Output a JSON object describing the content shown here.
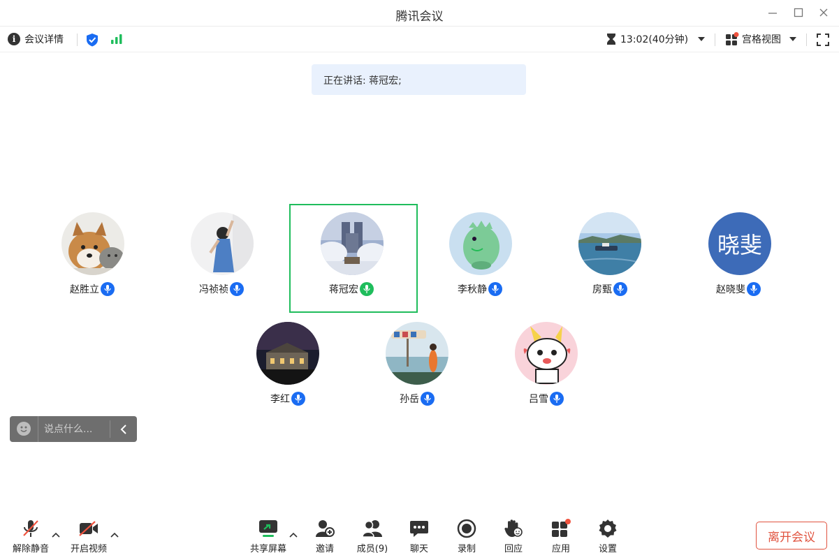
{
  "app": {
    "title": "腾讯会议"
  },
  "infobar": {
    "details_label": "会议详情",
    "timer": "13:02(40分钟)",
    "view_label": "宫格视图"
  },
  "speaking": {
    "text": "正在讲话: 蒋冠宏;"
  },
  "participants": [
    {
      "name": "赵胜立",
      "mic": "blue",
      "avatar": "dog-cat-photo"
    },
    {
      "name": "冯祯祯",
      "mic": "blue",
      "avatar": "girl-photo"
    },
    {
      "name": "蒋冠宏",
      "mic": "green",
      "avatar": "snowy-castle-photo",
      "active": true
    },
    {
      "name": "李秋静",
      "mic": "blue",
      "avatar": "green-dino-cartoon"
    },
    {
      "name": "房甄",
      "mic": "blue",
      "avatar": "sea-boat-photo"
    },
    {
      "name": "赵晓斐",
      "mic": "blue",
      "avatar": "text-avatar",
      "avatar_text": "晓斐",
      "avatar_color": "#3d6bb8"
    },
    {
      "name": "李红",
      "mic": "blue",
      "avatar": "night-building-photo"
    },
    {
      "name": "孙岳",
      "mic": "blue",
      "avatar": "beach-sign-photo"
    },
    {
      "name": "吕雪",
      "mic": "blue",
      "avatar": "cartoon-kid"
    }
  ],
  "chat": {
    "placeholder": "说点什么..."
  },
  "toolbar": {
    "unmute": "解除静音",
    "video": "开启视频",
    "share": "共享屏幕",
    "invite": "邀请",
    "members": "成员(9)",
    "chat": "聊天",
    "record": "录制",
    "react": "回应",
    "apps": "应用",
    "settings": "设置",
    "leave": "离开会议"
  },
  "colors": {
    "accent": "#1a6cf2",
    "active_border": "#1fbd5c",
    "leave": "#e0533f",
    "signal": "#1fbd5c",
    "badge": "#f0533f"
  }
}
